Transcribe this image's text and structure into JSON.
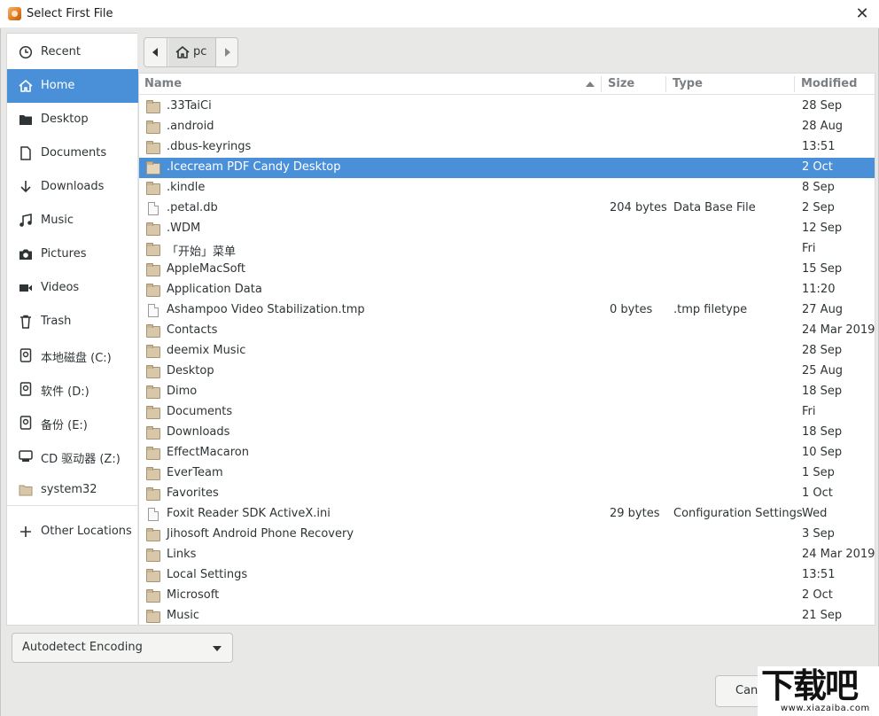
{
  "window": {
    "title": "Select First File",
    "close_glyph": "✕"
  },
  "sidebar": {
    "items": [
      {
        "label": "Recent",
        "icon": "clock-icon"
      },
      {
        "label": "Home",
        "icon": "home-icon"
      },
      {
        "label": "Desktop",
        "icon": "folder-icon"
      },
      {
        "label": "Documents",
        "icon": "document-icon"
      },
      {
        "label": "Downloads",
        "icon": "download-arrow-icon"
      },
      {
        "label": "Music",
        "icon": "music-note-icon"
      },
      {
        "label": "Pictures",
        "icon": "camera-icon"
      },
      {
        "label": "Videos",
        "icon": "video-icon"
      },
      {
        "label": "Trash",
        "icon": "trash-icon"
      },
      {
        "label": "本地磁盘 (C:)",
        "icon": "drive-icon"
      },
      {
        "label": "软件 (D:)",
        "icon": "drive-icon"
      },
      {
        "label": "备份 (E:)",
        "icon": "drive-icon"
      },
      {
        "label": "CD 驱动器 (Z:)",
        "icon": "optical-drive-icon"
      },
      {
        "label": "system32",
        "icon": "folder-icon"
      },
      {
        "label": "Other Locations",
        "icon": "plus-icon"
      }
    ],
    "active_index": 1
  },
  "pathbar": {
    "crumb_label": "pc"
  },
  "filelist": {
    "columns": {
      "name": "Name",
      "size": "Size",
      "type": "Type",
      "modified": "Modified"
    },
    "selected_index": 3,
    "rows": [
      {
        "name": ".33TaiCi",
        "size": "",
        "type": "",
        "modified": "28 Sep",
        "kind": "folder"
      },
      {
        "name": ".android",
        "size": "",
        "type": "",
        "modified": "28 Aug",
        "kind": "folder"
      },
      {
        "name": ".dbus-keyrings",
        "size": "",
        "type": "",
        "modified": "13:51",
        "kind": "folder"
      },
      {
        "name": ".Icecream PDF Candy Desktop",
        "size": "",
        "type": "",
        "modified": "2 Oct",
        "kind": "folder"
      },
      {
        "name": ".kindle",
        "size": "",
        "type": "",
        "modified": "8 Sep",
        "kind": "folder"
      },
      {
        "name": ".petal.db",
        "size": "204 bytes",
        "type": "Data Base File",
        "modified": "2 Sep",
        "kind": "file"
      },
      {
        "name": ".WDM",
        "size": "",
        "type": "",
        "modified": "12 Sep",
        "kind": "folder"
      },
      {
        "name": "「开始」菜单",
        "size": "",
        "type": "",
        "modified": "Fri",
        "kind": "folder"
      },
      {
        "name": "AppleMacSoft",
        "size": "",
        "type": "",
        "modified": "15 Sep",
        "kind": "folder"
      },
      {
        "name": "Application Data",
        "size": "",
        "type": "",
        "modified": "11:20",
        "kind": "folder"
      },
      {
        "name": "Ashampoo Video Stabilization.tmp",
        "size": "0 bytes",
        "type": ".tmp filetype",
        "modified": "27 Aug",
        "kind": "file"
      },
      {
        "name": "Contacts",
        "size": "",
        "type": "",
        "modified": "24 Mar 2019",
        "kind": "folder"
      },
      {
        "name": "deemix Music",
        "size": "",
        "type": "",
        "modified": "28 Sep",
        "kind": "folder"
      },
      {
        "name": "Desktop",
        "size": "",
        "type": "",
        "modified": "25 Aug",
        "kind": "folder"
      },
      {
        "name": "Dimo",
        "size": "",
        "type": "",
        "modified": "18 Sep",
        "kind": "folder"
      },
      {
        "name": "Documents",
        "size": "",
        "type": "",
        "modified": "Fri",
        "kind": "folder"
      },
      {
        "name": "Downloads",
        "size": "",
        "type": "",
        "modified": "18 Sep",
        "kind": "folder"
      },
      {
        "name": "EffectMacaron",
        "size": "",
        "type": "",
        "modified": "10 Sep",
        "kind": "folder"
      },
      {
        "name": "EverTeam",
        "size": "",
        "type": "",
        "modified": "1 Sep",
        "kind": "folder"
      },
      {
        "name": "Favorites",
        "size": "",
        "type": "",
        "modified": "1 Oct",
        "kind": "folder"
      },
      {
        "name": "Foxit Reader SDK ActiveX.ini",
        "size": "29 bytes",
        "type": "Configuration Settings",
        "modified": "Wed",
        "kind": "file"
      },
      {
        "name": "Jihosoft Android Phone Recovery",
        "size": "",
        "type": "",
        "modified": "3 Sep",
        "kind": "folder"
      },
      {
        "name": "Links",
        "size": "",
        "type": "",
        "modified": "24 Mar 2019",
        "kind": "folder"
      },
      {
        "name": "Local Settings",
        "size": "",
        "type": "",
        "modified": "13:51",
        "kind": "folder"
      },
      {
        "name": "Microsoft",
        "size": "",
        "type": "",
        "modified": "2 Oct",
        "kind": "folder"
      },
      {
        "name": "Music",
        "size": "",
        "type": "",
        "modified": "21 Sep",
        "kind": "folder"
      }
    ]
  },
  "encoding": {
    "selected": "Autodetect Encoding"
  },
  "buttons": {
    "cancel_label": "Canc"
  },
  "watermark": {
    "main": "下载吧",
    "sub": "www.xiazaiba.com"
  },
  "colors": {
    "accent": "#4a90d9"
  }
}
